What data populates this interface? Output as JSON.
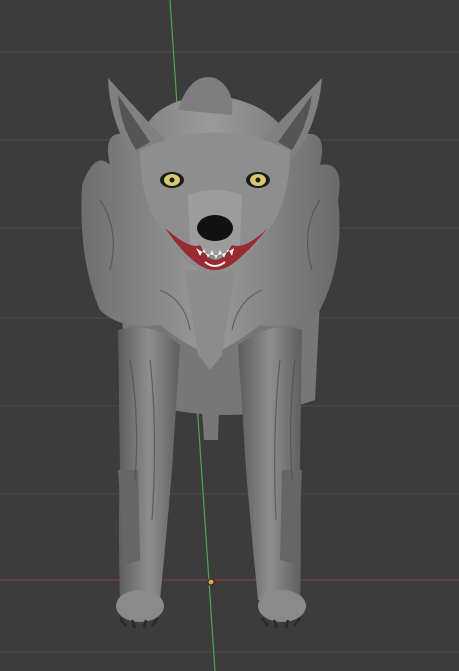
{
  "viewport": {
    "background_color": "#3c3c3c",
    "grid_color": "#4b4b4b",
    "y_axis_color": "#4fa84f",
    "x_axis_color": "#8a3a3a",
    "origin_marker_color": "#e8a25a"
  },
  "model": {
    "subject": "wolf",
    "fur_color": "#8a8a8a",
    "fur_dark": "#5a5a5a",
    "eye_color": "#d8c870",
    "mouth_color": "#b03038",
    "teeth_color": "#f2f2f2"
  }
}
